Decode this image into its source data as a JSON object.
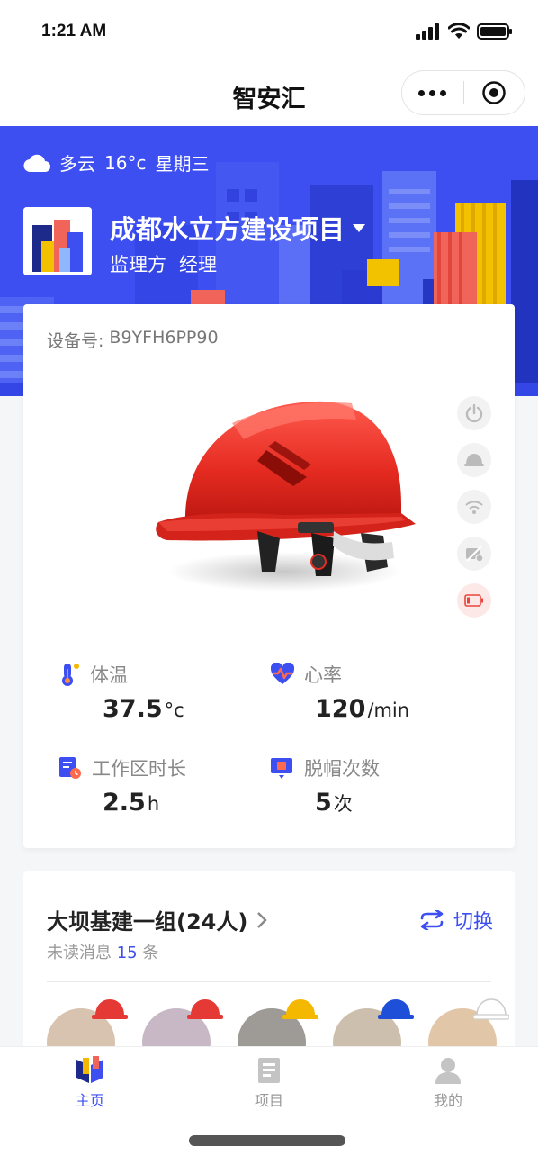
{
  "status_bar": {
    "time": "1:21 AM"
  },
  "nav": {
    "title": "智安汇"
  },
  "banner": {
    "weather": {
      "condition": "多云",
      "temperature": "16°c",
      "weekday": "星期三"
    },
    "project": {
      "name": "成都水立方建设项目",
      "org": "监理方",
      "role": "经理"
    }
  },
  "device": {
    "label": "设备号:",
    "number": "B9YFH6PP90",
    "metrics": [
      {
        "label": "体温",
        "value": "37.5",
        "unit": "°c"
      },
      {
        "label": "心率",
        "value": "120",
        "unit": "/min"
      },
      {
        "label": "工作区时长",
        "value": "2.5",
        "unit": "h"
      },
      {
        "label": "脱帽次数",
        "value": "5",
        "unit": "次"
      }
    ]
  },
  "team": {
    "name": "大坝基建一组(24人)",
    "switch_label": "切换",
    "unread_prefix": "未读消息",
    "unread_count": "15",
    "unread_suffix": "条",
    "helmet_colors": [
      "#e53935",
      "#e53935",
      "#f5b800",
      "#1e4fd8",
      "#ffffff"
    ]
  },
  "tabs": [
    {
      "label": "主页",
      "active": true
    },
    {
      "label": "项目",
      "active": false
    },
    {
      "label": "我的",
      "active": false
    }
  ],
  "colors": {
    "accent": "#3d4ff0",
    "helmet": "#e52b21",
    "battery_alert": "#e8453c"
  }
}
